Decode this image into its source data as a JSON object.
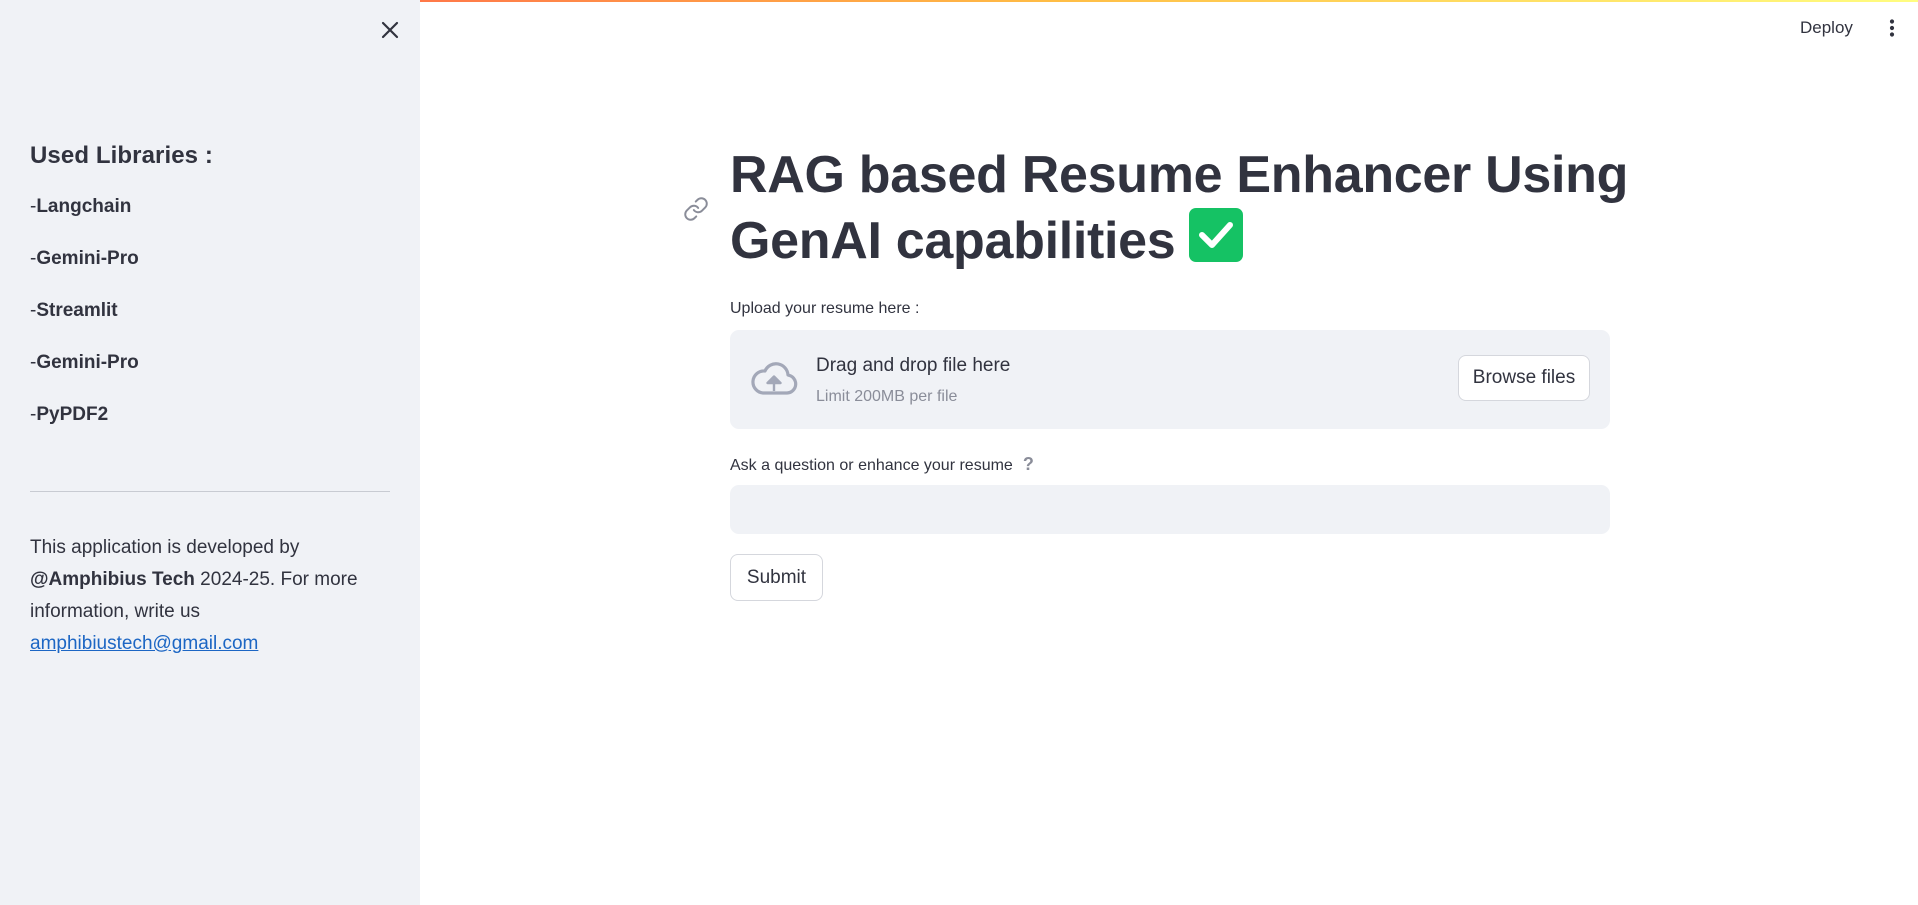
{
  "sidebar": {
    "heading": "Used Libraries :",
    "libraries": [
      {
        "prefix": "-",
        "name": "Langchain"
      },
      {
        "prefix": "-",
        "name": "Gemini-Pro"
      },
      {
        "prefix": "-",
        "name": "Streamlit"
      },
      {
        "prefix": "-",
        "name": "Gemini-Pro"
      },
      {
        "prefix": "-",
        "name": "PyPDF2"
      }
    ],
    "about": {
      "intro": "This application is developed by ",
      "author": "@Amphibius Tech",
      "rest": " 2024-25. For more information, write us ",
      "email": "amphibiustech@gmail.com"
    }
  },
  "header": {
    "deploy_label": "Deploy",
    "menu_icon": "more-vertical-icon"
  },
  "main": {
    "title_line1": "RAG based Resume Enhancer Using",
    "title_line2": "GenAI capabilities",
    "title_emoji": "check-mark-button-icon",
    "uploader": {
      "label": "Upload your resume here :",
      "drop_text": "Drag and drop file here",
      "limit_text": "Limit 200MB per file",
      "browse_label": "Browse files",
      "icon": "cloud-upload-icon"
    },
    "question": {
      "label": "Ask a question or enhance your resume",
      "help_glyph": "?",
      "value": ""
    },
    "submit_label": "Submit"
  },
  "colors": {
    "sidebar_bg": "#f0f2f6",
    "text": "#31333f",
    "link": "#1c66c4",
    "emoji_green": "#15c264",
    "top_accent": "#ff4b4b"
  }
}
